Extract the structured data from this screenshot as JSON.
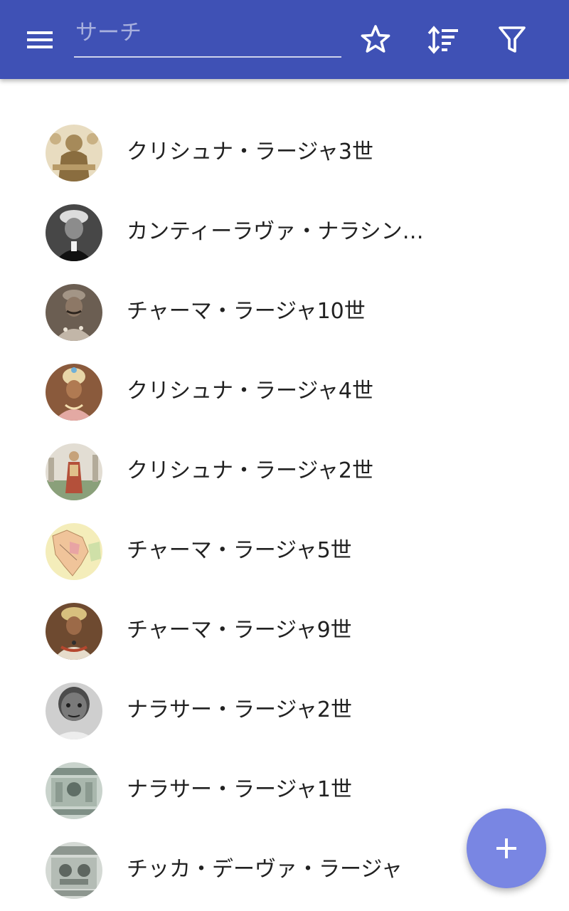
{
  "colors": {
    "appbar": "#3f51b5",
    "fab": "#7986e3",
    "text": "#212121"
  },
  "toolbar": {
    "menu_icon": "menu-icon",
    "search_placeholder": "サーチ",
    "search_value": "",
    "favorites_icon": "star-outline-icon",
    "sort_icon": "sort-icon",
    "filter_icon": "filter-icon"
  },
  "list": {
    "items": [
      {
        "label": "クリシュナ・ラージャ3世",
        "avatar": "sepia-ornate-portrait"
      },
      {
        "label": "カンティーラヴァ・ナラシンハ・ラージャ",
        "avatar": "bw-turban-portrait"
      },
      {
        "label": "チャーマ・ラージャ10世",
        "avatar": "sepia-mustache-portrait"
      },
      {
        "label": "クリシュナ・ラージャ4世",
        "avatar": "color-turban-portrait"
      },
      {
        "label": "クリシュナ・ラージャ2世",
        "avatar": "painted-standing-figure"
      },
      {
        "label": "チャーマ・ラージャ5世",
        "avatar": "map-thumbnail"
      },
      {
        "label": "チャーマ・ラージャ9世",
        "avatar": "painted-noble-portrait"
      },
      {
        "label": "ナラサー・ラージャ2世",
        "avatar": "bw-elder-photo"
      },
      {
        "label": "ナラサー・ラージャ1世",
        "avatar": "banknote-engraving"
      },
      {
        "label": "チッカ・デーヴァ・ラージャ",
        "avatar": "banknote-engraving-2"
      }
    ]
  },
  "fab": {
    "icon": "plus-icon"
  }
}
